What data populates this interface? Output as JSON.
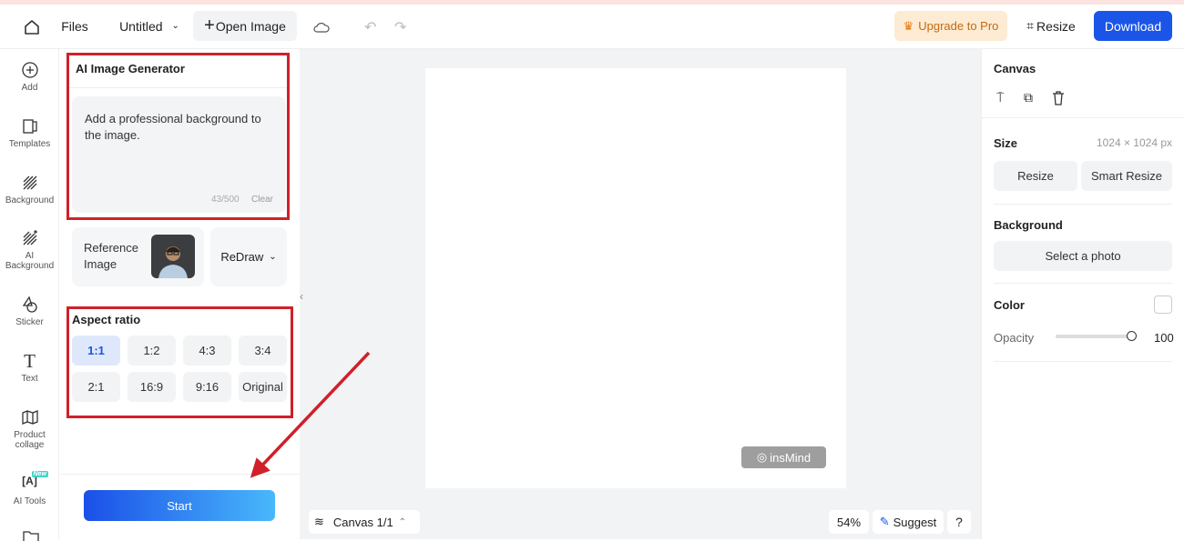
{
  "header": {
    "files": "Files",
    "doc_title": "Untitled",
    "open_image": "Open Image",
    "upgrade": "Upgrade to Pro",
    "resize": "Resize",
    "download": "Download"
  },
  "sidebar": {
    "items": [
      {
        "label": "Add",
        "icon": "plus-circle-icon"
      },
      {
        "label": "Templates",
        "icon": "templates-icon"
      },
      {
        "label": "Background",
        "icon": "background-icon"
      },
      {
        "label": "AI Background",
        "icon": "ai-background-icon"
      },
      {
        "label": "Sticker",
        "icon": "sticker-icon"
      },
      {
        "label": "Text",
        "icon": "text-icon"
      },
      {
        "label": "Product collage",
        "icon": "collage-icon"
      },
      {
        "label": "AI Tools",
        "icon": "ai-tools-icon",
        "badge": "New"
      }
    ]
  },
  "generator": {
    "title": "AI Image Generator",
    "prompt": "Add a professional background to the image.",
    "count": "43/500",
    "clear": "Clear",
    "reference_label": "Reference Image",
    "mode": "ReDraw",
    "aspect_title": "Aspect ratio",
    "ratios": [
      "1:1",
      "1:2",
      "4:3",
      "3:4",
      "2:1",
      "16:9",
      "9:16",
      "Original"
    ],
    "selected_ratio": "1:1",
    "start": "Start"
  },
  "canvas": {
    "watermark": "insMind",
    "pages": "Canvas 1/1",
    "zoom": "54%",
    "suggest": "Suggest",
    "help": "?"
  },
  "right_panel": {
    "title": "Canvas",
    "size_label": "Size",
    "size_value": "1024 × 1024 px",
    "resize": "Resize",
    "smart_resize": "Smart Resize",
    "background_label": "Background",
    "select_photo": "Select a photo",
    "color_label": "Color",
    "opacity_label": "Opacity",
    "opacity_value": "100"
  },
  "colors": {
    "accent": "#1b55e8",
    "annotation": "#d0202a",
    "upgrade_bg": "#fdebd3",
    "upgrade_text": "#c26a10"
  }
}
